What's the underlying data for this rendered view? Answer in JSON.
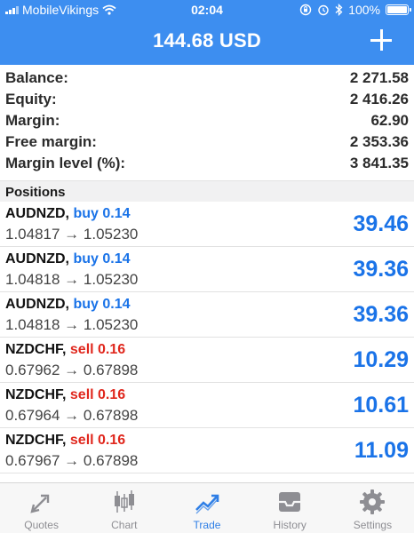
{
  "status_bar": {
    "carrier": "MobileVikings",
    "time": "02:04",
    "battery": "100%"
  },
  "header": {
    "title": "144.68 USD",
    "add_icon": "plus-icon"
  },
  "summary": [
    {
      "label": "Balance:",
      "value": "2 271.58"
    },
    {
      "label": "Equity:",
      "value": "2 416.26"
    },
    {
      "label": "Margin:",
      "value": "62.90"
    },
    {
      "label": "Free margin:",
      "value": "2 353.36"
    },
    {
      "label": "Margin level (%):",
      "value": "3 841.35"
    }
  ],
  "positions_label": "Positions",
  "positions": [
    {
      "symbol": "AUDNZD,",
      "side": "buy 0.14",
      "side_type": "buy",
      "prices": "1.04817 → 1.05230",
      "profit": "39.46"
    },
    {
      "symbol": "AUDNZD,",
      "side": "buy 0.14",
      "side_type": "buy",
      "prices": "1.04818 → 1.05230",
      "profit": "39.36"
    },
    {
      "symbol": "AUDNZD,",
      "side": "buy 0.14",
      "side_type": "buy",
      "prices": "1.04818 → 1.05230",
      "profit": "39.36"
    },
    {
      "symbol": "NZDCHF,",
      "side": "sell 0.16",
      "side_type": "sell",
      "prices": "0.67962 → 0.67898",
      "profit": "10.29"
    },
    {
      "symbol": "NZDCHF,",
      "side": "sell 0.16",
      "side_type": "sell",
      "prices": "0.67964 → 0.67898",
      "profit": "10.61"
    },
    {
      "symbol": "NZDCHF,",
      "side": "sell 0.16",
      "side_type": "sell",
      "prices": "0.67967 → 0.67898",
      "profit": "11.09"
    }
  ],
  "tabs": [
    {
      "label": "Quotes",
      "icon": "quotes-icon",
      "active": false
    },
    {
      "label": "Chart",
      "icon": "candlestick-chart-icon",
      "active": false
    },
    {
      "label": "Trade",
      "icon": "trade-icon",
      "active": true
    },
    {
      "label": "History",
      "icon": "inbox-tray-icon",
      "active": false
    },
    {
      "label": "Settings",
      "icon": "gear-icon",
      "active": false
    }
  ],
  "colors": {
    "header_bg": "#3d8ef0",
    "buy": "#1a73e8",
    "sell": "#e0281e",
    "profit": "#1a73e8",
    "tab_active": "#2f7fe6",
    "tab_inactive": "#8e8e93"
  }
}
